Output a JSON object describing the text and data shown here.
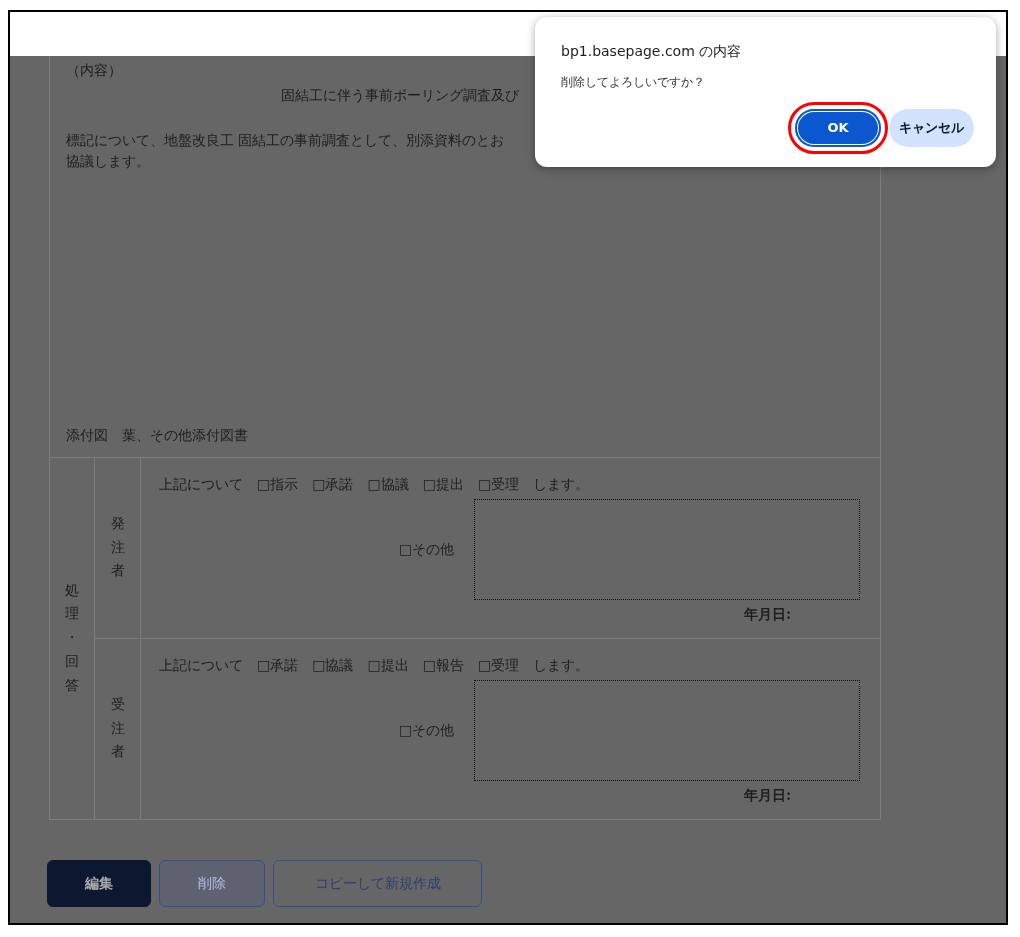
{
  "dialog": {
    "title": "bp1.basepage.com の内容",
    "message": "削除してよろしいですか？",
    "buttons": [
      {
        "label": "OK",
        "kind": "primary",
        "highlighted": true
      },
      {
        "label": "キャンセル",
        "kind": "secondary",
        "highlighted": false
      }
    ]
  },
  "form": {
    "content_label": "（内容）",
    "subject": "固結工に伴う事前ボーリング調査及び",
    "body": [
      "標記について、地盤改良工 固結工の事前調査として、別添資料のとお",
      "協議します。"
    ],
    "attachments": "添付図　葉、その他添付図書",
    "section_label": "処理・回答",
    "parties": [
      {
        "label": "発注者",
        "lead": "上記について",
        "options": [
          "□指示",
          "□承諾",
          "□協議",
          "□提出",
          "□受理"
        ],
        "tail": "します。",
        "other": "□その他",
        "date_label": "年月日:"
      },
      {
        "label": "受注者",
        "lead": "上記について",
        "options": [
          "□承諾",
          "□協議",
          "□提出",
          "□報告",
          "□受理"
        ],
        "tail": "します。",
        "other": "□その他",
        "date_label": "年月日:"
      }
    ]
  },
  "buttons": [
    {
      "label": "編集",
      "kind": "primary",
      "disabled": false
    },
    {
      "label": "削除",
      "kind": "outline",
      "disabled": true
    },
    {
      "label": "コピーして新規作成",
      "kind": "outline",
      "disabled": false
    }
  ]
}
